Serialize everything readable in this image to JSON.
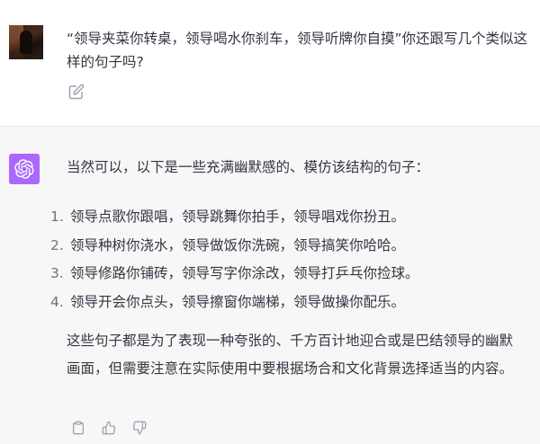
{
  "user_message": {
    "text": "“领导夹菜你转桌，领导喝水你刹车，领导听牌你自摸”你还跟写几个类似这样的句子吗?"
  },
  "assistant_message": {
    "intro": "当然可以，以下是一些充满幽默感的、模仿该结构的句子：",
    "items": [
      {
        "num": "1.",
        "text": "领导点歌你跟唱，领导跳舞你拍手，领导唱戏你扮丑。"
      },
      {
        "num": "2.",
        "text": "领导种树你浇水，领导做饭你洗碗，领导搞笑你哈哈。"
      },
      {
        "num": "3.",
        "text": "领导修路你铺砖，领导写字你涂改，领导打乒乓你捡球。"
      },
      {
        "num": "4.",
        "text": "领导开会你点头，领导擦窗你端梯，领导做操你配乐。"
      }
    ],
    "closing": "这些句子都是为了表现一种夸张的、千方百计地迎合或是巴结领导的幽默画面，但需要注意在实际使用中要根据场合和文化背景选择适当的内容。"
  },
  "icons": {
    "edit": "edit-icon",
    "assistant_logo": "openai-logo-icon",
    "copy": "clipboard-icon",
    "thumbs_up": "thumbs-up-icon",
    "thumbs_down": "thumbs-down-icon"
  },
  "colors": {
    "assistant_avatar_bg": "#ab68ff",
    "assistant_block_bg": "#f7f7f8",
    "text": "#343541"
  }
}
